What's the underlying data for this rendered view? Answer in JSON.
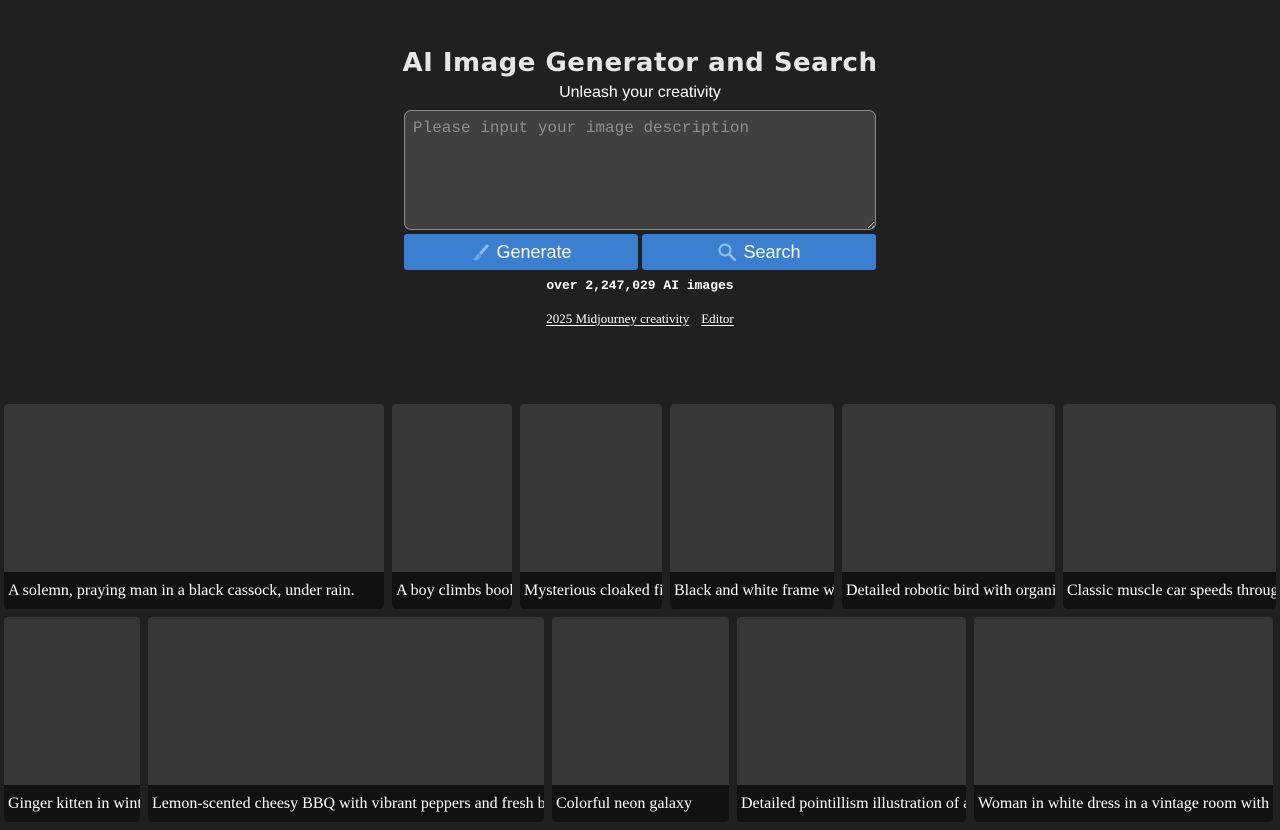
{
  "header": {
    "title": "AI Image Generator and Search",
    "subtitle": "Unleash your creativity"
  },
  "prompt": {
    "placeholder": "Please input your image description",
    "value": ""
  },
  "buttons": {
    "generate_label": "Generate",
    "generate_icon": "brush-icon",
    "search_label": "Search",
    "search_icon": "search-icon"
  },
  "stats": {
    "text": "over 2,247,029 AI images"
  },
  "links": [
    {
      "label": "2025 Midjourney creativity"
    },
    {
      "label": "Editor"
    }
  ],
  "gallery": {
    "rows": [
      [
        {
          "caption": "A solemn, praying man in a black cassock, under rain."
        },
        {
          "caption": "A boy climbs bookshelves"
        },
        {
          "caption": "Mysterious cloaked figure"
        },
        {
          "caption": "Black and white frame with"
        },
        {
          "caption": "Detailed robotic bird with organic"
        },
        {
          "caption": "Classic muscle car speeds through"
        }
      ],
      [
        {
          "caption": "Ginger kitten in winter"
        },
        {
          "caption": "Lemon-scented cheesy BBQ with vibrant peppers and fresh basil on top"
        },
        {
          "caption": "Colorful neon galaxy"
        },
        {
          "caption": "Detailed pointillism illustration of a"
        },
        {
          "caption": "Woman in white dress in a vintage room with"
        }
      ]
    ]
  },
  "colors": {
    "background": "#202020",
    "accent": "#3a7fd0",
    "card": "#363636",
    "caption_bg": "#111111"
  }
}
